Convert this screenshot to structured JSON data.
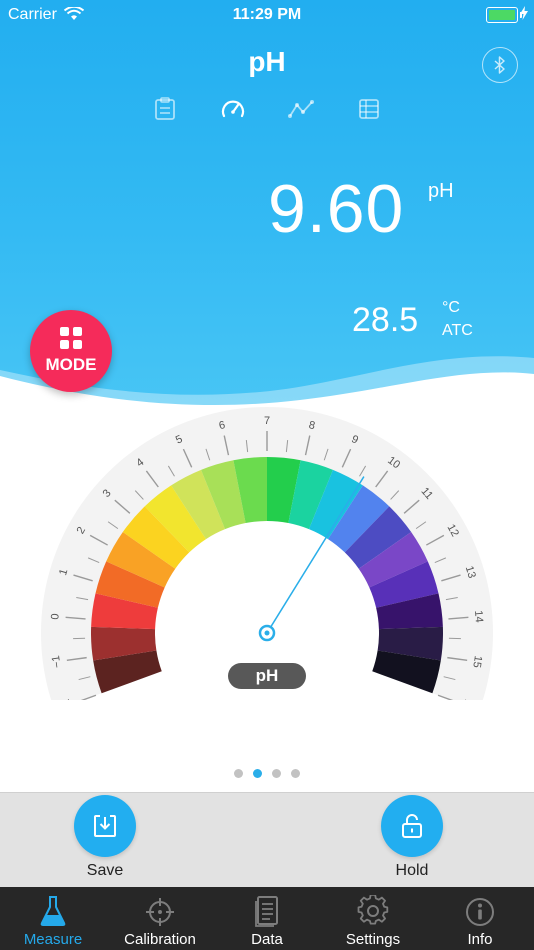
{
  "status_bar": {
    "carrier": "Carrier",
    "time": "11:29 PM"
  },
  "header": {
    "title": "pH"
  },
  "reading": {
    "value": "9.60",
    "unit": "pH"
  },
  "temperature": {
    "value": "28.5",
    "unit": "°C",
    "mode": "ATC"
  },
  "mode_button": {
    "label": "MODE"
  },
  "gauge": {
    "value": 9.6,
    "min": -2,
    "max": 16,
    "label": "pH",
    "scale_labels": [
      "−2",
      "−1",
      "0",
      "1",
      "2",
      "3",
      "4",
      "5",
      "6",
      "7",
      "8",
      "9",
      "10",
      "11",
      "12",
      "13",
      "14",
      "15",
      "16"
    ],
    "colors": [
      "#5c2320",
      "#9c302f",
      "#ee3c3c",
      "#f26b26",
      "#f9a225",
      "#fbd320",
      "#f2e52e",
      "#d0e35a",
      "#a8e058",
      "#6bdb4e",
      "#23ce4c",
      "#1bd3a0",
      "#19c2e0",
      "#5283ee",
      "#4d4cc2",
      "#7a47c7",
      "#5830b8",
      "#37136b",
      "#291c46",
      "#12111f"
    ],
    "colors_used": [
      "#5c2320",
      "#9c302f",
      "#ee3c3c",
      "#f26b26",
      "#f9a225",
      "#fbd320",
      "#f2e52e",
      "#d0e35a",
      "#a8e058",
      "#6bdb4e",
      "#23ce4c",
      "#1bd3a0",
      "#19c2e0",
      "#5283ee",
      "#4d4cc2",
      "#7a47c7",
      "#5830b8",
      "#37136b",
      "#291c46",
      "#12111f"
    ],
    "needle_color": "#2aaee9"
  },
  "pager": {
    "pages": 4,
    "active": 1
  },
  "actions": {
    "save": "Save",
    "hold": "Hold"
  },
  "tabbar": {
    "items": [
      {
        "label": "Measure",
        "icon": "flask-icon"
      },
      {
        "label": "Calibration",
        "icon": "crosshair-icon"
      },
      {
        "label": "Data",
        "icon": "document-icon"
      },
      {
        "label": "Settings",
        "icon": "gear-icon"
      },
      {
        "label": "Info",
        "icon": "info-icon"
      }
    ],
    "active_index": 0
  },
  "colors": {
    "header": "#22aef0",
    "mode_button": "#f52b5a",
    "accent": "#25a9ea",
    "tabbar": "#272727"
  }
}
